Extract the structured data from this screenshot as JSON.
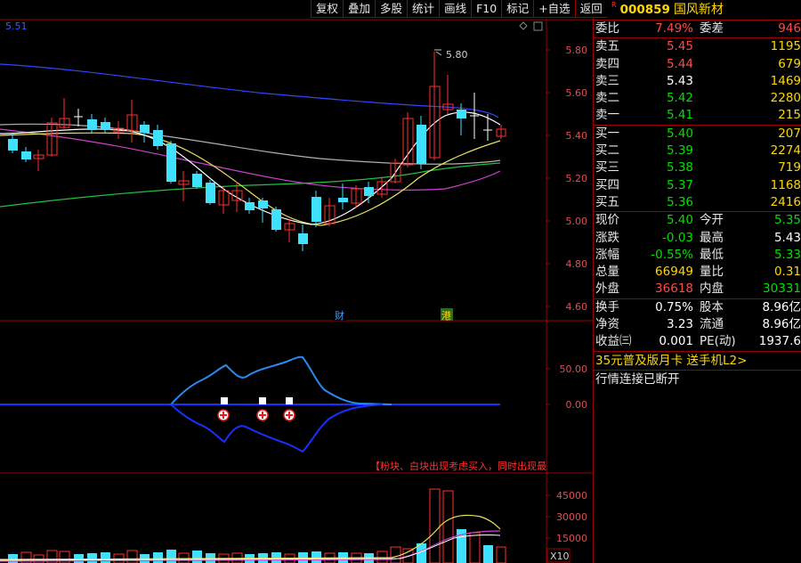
{
  "toolbar": {
    "buttons": [
      "复权",
      "叠加",
      "多股",
      "统计",
      "画线",
      "F10",
      "标记",
      "+自选",
      "返回"
    ]
  },
  "chart": {
    "ma_value": "5.51",
    "price_axis": [
      "5.80",
      "5.60",
      "5.40",
      "5.20",
      "5.00",
      "4.80",
      "4.60"
    ],
    "high_marker": "5.80",
    "event_cai": "财",
    "event_gang": "港",
    "indicator_axis": [
      "50.00",
      "0.00"
    ],
    "signal_text": "【粉块、白块出现考虑买入，同时出现最",
    "volume_axis": [
      "45000",
      "30000",
      "15000"
    ],
    "volume_unit": "X10"
  },
  "stock": {
    "r_badge": "R",
    "code": "000859",
    "name": "国风新材"
  },
  "quote": {
    "weibi_label": "委比",
    "weibi": "7.49%",
    "weicha_label": "委差",
    "weicha": "946",
    "asks": [
      {
        "label": "卖五",
        "price": "5.45",
        "vol": "1195"
      },
      {
        "label": "卖四",
        "price": "5.44",
        "vol": "679"
      },
      {
        "label": "卖三",
        "price": "5.43",
        "vol": "1469"
      },
      {
        "label": "卖二",
        "price": "5.42",
        "vol": "2280"
      },
      {
        "label": "卖一",
        "price": "5.41",
        "vol": "215"
      }
    ],
    "bids": [
      {
        "label": "买一",
        "price": "5.40",
        "vol": "207"
      },
      {
        "label": "买二",
        "price": "5.39",
        "vol": "2274"
      },
      {
        "label": "买三",
        "price": "5.38",
        "vol": "719"
      },
      {
        "label": "买四",
        "price": "5.37",
        "vol": "1168"
      },
      {
        "label": "买五",
        "price": "5.36",
        "vol": "2416"
      }
    ],
    "stats": [
      {
        "l1": "现价",
        "v1": "5.40",
        "l2": "今开",
        "v2": "5.35"
      },
      {
        "l1": "涨跌",
        "v1": "-0.03",
        "l2": "最高",
        "v2": "5.43"
      },
      {
        "l1": "涨幅",
        "v1": "-0.55%",
        "l2": "最低",
        "v2": "5.33"
      },
      {
        "l1": "总量",
        "v1": "66949",
        "l2": "量比",
        "v2": "0.31"
      },
      {
        "l1": "外盘",
        "v1": "36618",
        "l2": "内盘",
        "v2": "30331"
      }
    ],
    "extra": [
      {
        "l1": "换手",
        "v1": "0.75%",
        "l2": "股本",
        "v2": "8.96亿"
      },
      {
        "l1": "净资",
        "v1": "3.23",
        "l2": "流通",
        "v2": "8.96亿"
      },
      {
        "l1": "收益㈢",
        "v1": "0.001",
        "l2": "PE(动)",
        "v2": "1937.6"
      }
    ]
  },
  "promo": "35元普及版月卡 送手机L2>",
  "status": "行情连接已断开"
}
